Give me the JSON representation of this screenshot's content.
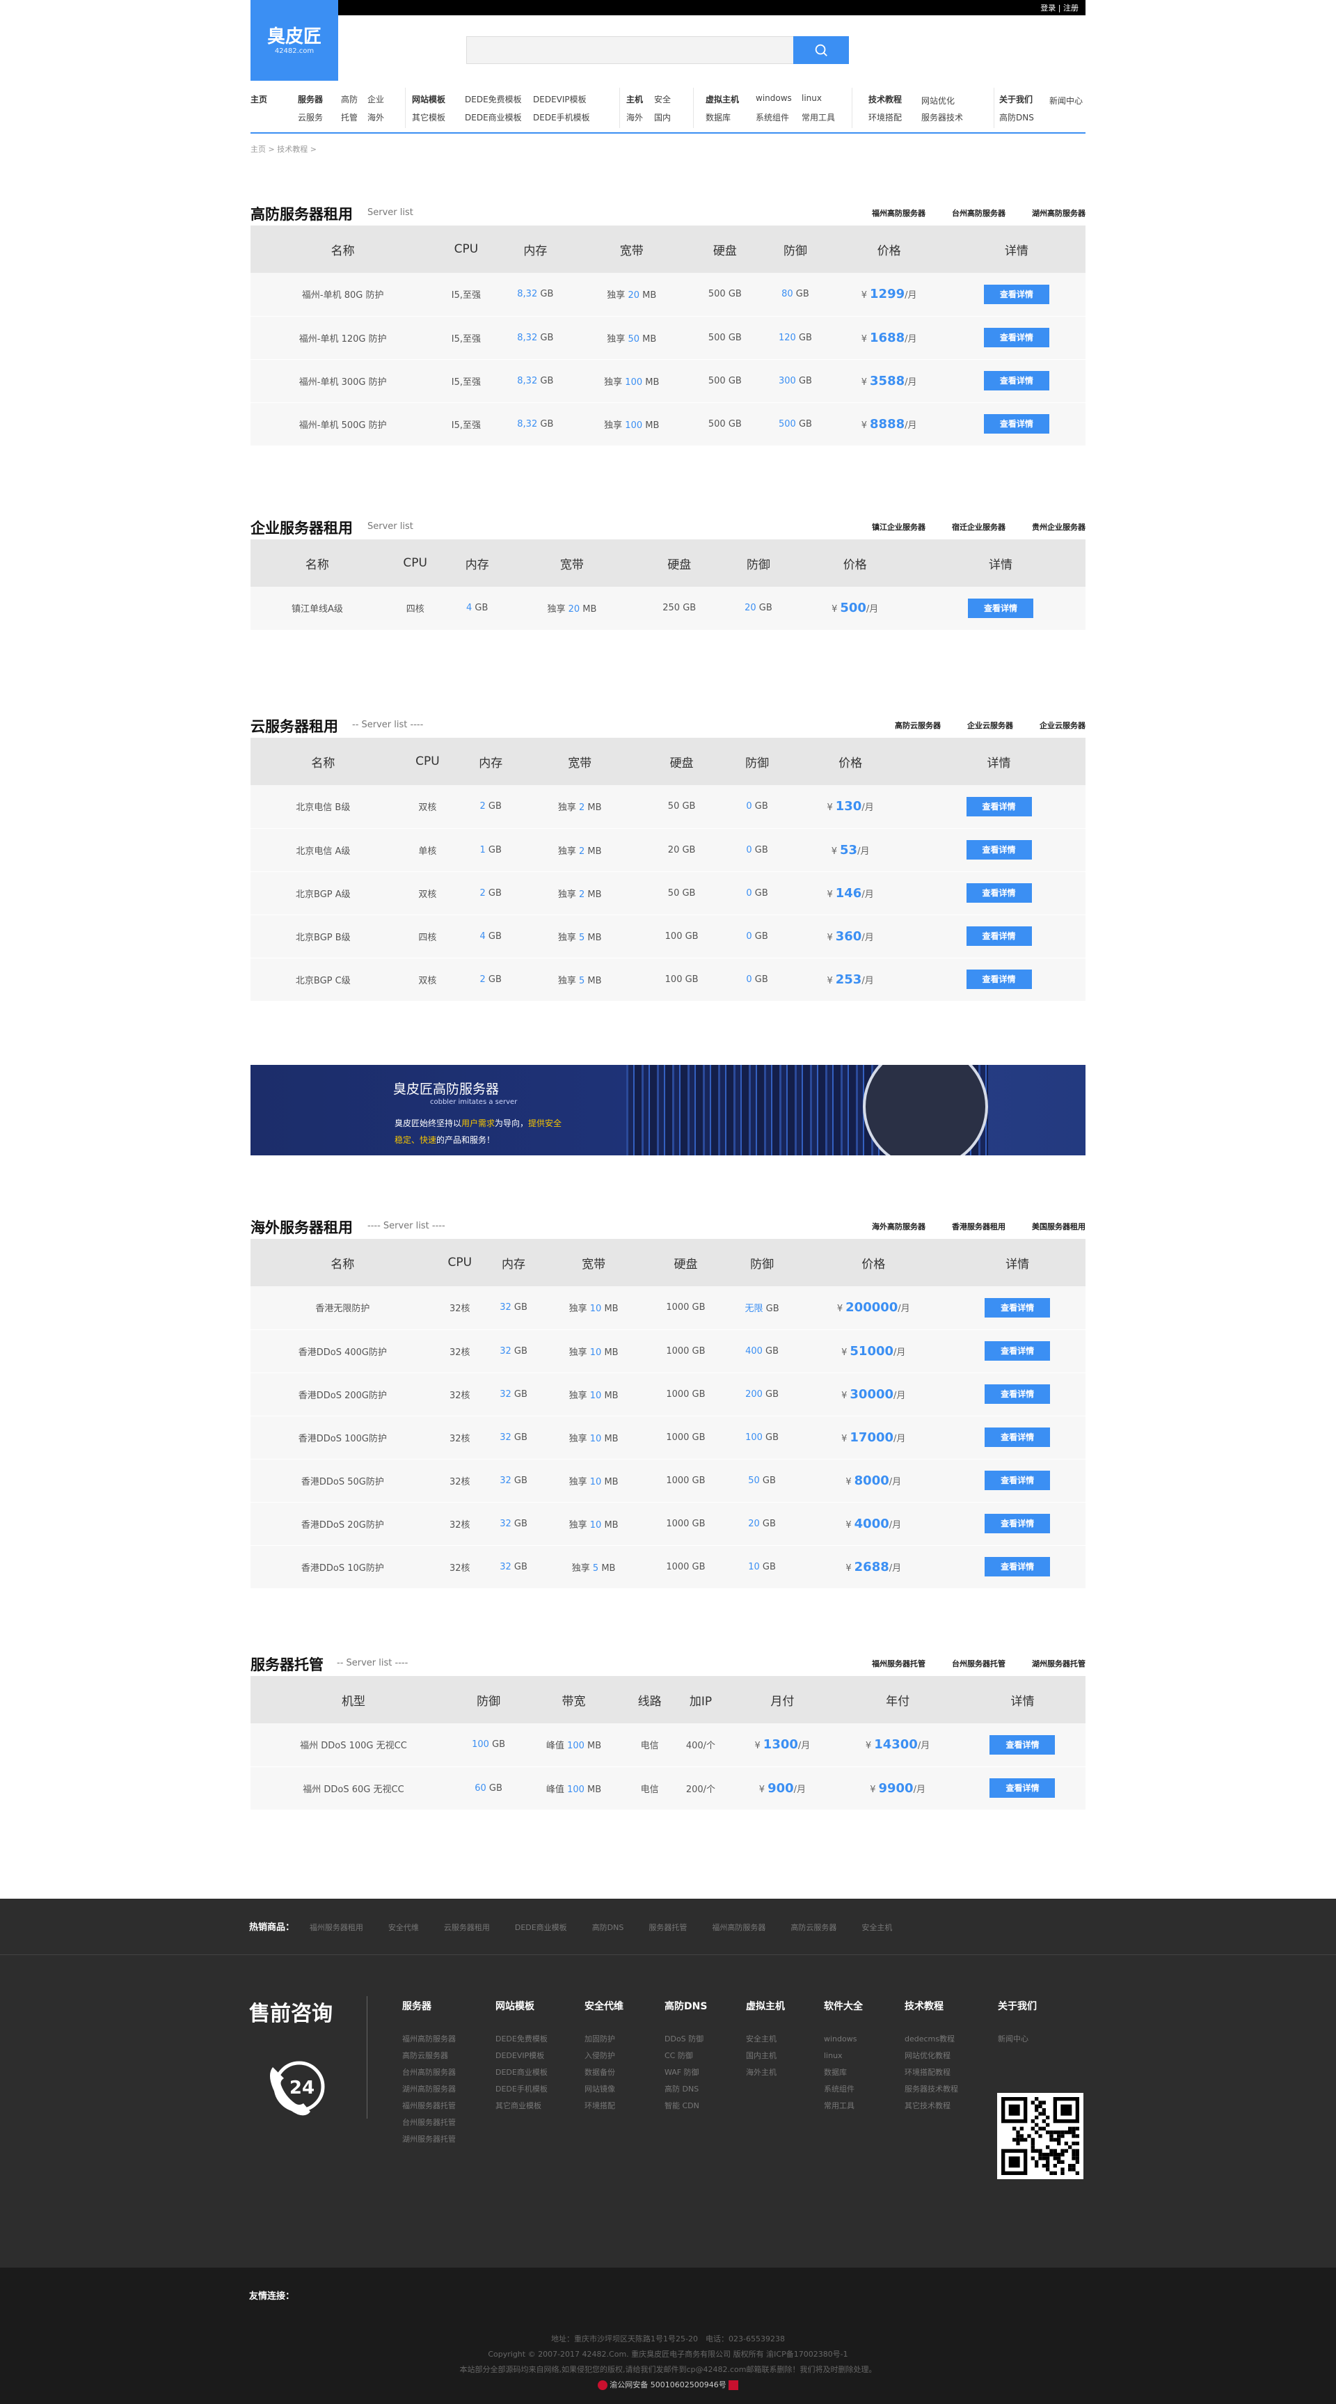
{
  "top_links": {
    "login": "登录",
    "sep": "|",
    "register": "注册"
  },
  "logo": {
    "mark": "臭皮匠",
    "sub": "42482.com"
  },
  "nav": [
    {
      "title": "主页",
      "items": []
    },
    {
      "title": "服务器",
      "items": [
        "高防",
        "企业",
        "云服务",
        "托管",
        "海外"
      ]
    },
    {
      "title": "网站模板",
      "items": [
        "DEDE免费模板",
        "DEDEVIP模板",
        "其它模板",
        "DEDE商业模板",
        "DEDE手机模板"
      ]
    },
    {
      "title": "主机",
      "items": [
        "安全",
        "海外",
        "国内"
      ]
    },
    {
      "title": "虚拟主机",
      "items": [
        "windows",
        "linux",
        "数据库",
        "系统组件",
        "常用工具"
      ]
    },
    {
      "title": "技术教程",
      "items": [
        "网站优化",
        "环境搭配",
        "服务器技术"
      ]
    },
    {
      "title": "关于我们",
      "items": [
        "新闻中心",
        "高防DNS"
      ]
    }
  ],
  "breadcrumb": "主页 >  技术教程 >",
  "sections": [
    {
      "title": "高防服务器租用",
      "sub": "Server list",
      "links": [
        "福州高防服务器",
        "台州高防服务器",
        "湖州高防服务器"
      ],
      "headers": [
        "名称",
        "CPU",
        "内存",
        "宽带",
        "硬盘",
        "防御",
        "价格",
        "详情"
      ],
      "rows": [
        [
          "福州-单机 80G 防护",
          "I5,至强",
          "8,32",
          "20",
          "500 GB",
          "80",
          "1299"
        ],
        [
          "福州-单机 120G 防护",
          "I5,至强",
          "8,32",
          "50",
          "500 GB",
          "120",
          "1688"
        ],
        [
          "福州-单机 300G 防护",
          "I5,至强",
          "8,32",
          "100",
          "500 GB",
          "300",
          "3588"
        ],
        [
          "福州-单机 500G 防护",
          "I5,至强",
          "8,32",
          "100",
          "500 GB",
          "500",
          "8888"
        ]
      ]
    },
    {
      "title": "企业服务器租用",
      "sub": "Server list",
      "links": [
        "镇江企业服务器",
        "宿迁企业服务器",
        "贵州企业服务器"
      ],
      "headers": [
        "名称",
        "CPU",
        "内存",
        "宽带",
        "硬盘",
        "防御",
        "价格",
        "详情"
      ],
      "rows": [
        [
          "镇江单线A级",
          "四核",
          "4",
          "20",
          "250 GB",
          "20",
          "500"
        ]
      ]
    },
    {
      "title": "云服务器租用",
      "sub": "-- Server list ----",
      "links": [
        "高防云服务器",
        "企业云服务器",
        "企业云服务器"
      ],
      "headers": [
        "名称",
        "CPU",
        "内存",
        "宽带",
        "硬盘",
        "防御",
        "价格",
        "详情"
      ],
      "rows": [
        [
          "北京电信 B级",
          "双核",
          "2",
          "2",
          "50 GB",
          "0",
          "130"
        ],
        [
          "北京电信 A级",
          "单核",
          "1",
          "2",
          "20 GB",
          "0",
          "53"
        ],
        [
          "北京BGP A级",
          "双核",
          "2",
          "2",
          "50 GB",
          "0",
          "146"
        ],
        [
          "北京BGP B级",
          "四核",
          "4",
          "5",
          "100 GB",
          "0",
          "360"
        ],
        [
          "北京BGP C级",
          "双核",
          "2",
          "5",
          "100 GB",
          "0",
          "253"
        ]
      ]
    },
    {
      "title": "海外服务器租用",
      "sub": "---- Server list ----",
      "links": [
        "海外高防服务器",
        "香港服务器租用",
        "美国服务器租用"
      ],
      "headers": [
        "名称",
        "CPU",
        "内存",
        "宽带",
        "硬盘",
        "防御",
        "价格",
        "详情"
      ],
      "rows": [
        [
          "香港无限防护",
          "32核",
          "32",
          "10",
          "1000 GB",
          "无限",
          "200000"
        ],
        [
          "香港DDoS 400G防护",
          "32核",
          "32",
          "10",
          "1000 GB",
          "400",
          "51000"
        ],
        [
          "香港DDoS 200G防护",
          "32核",
          "32",
          "10",
          "1000 GB",
          "200",
          "30000"
        ],
        [
          "香港DDoS 100G防护",
          "32核",
          "32",
          "10",
          "1000 GB",
          "100",
          "17000"
        ],
        [
          "香港DDoS 50G防护",
          "32核",
          "32",
          "10",
          "1000 GB",
          "50",
          "8000"
        ],
        [
          "香港DDoS 20G防护",
          "32核",
          "32",
          "10",
          "1000 GB",
          "20",
          "4000"
        ],
        [
          "香港DDoS 10G防护",
          "32核",
          "32",
          "5",
          "1000 GB",
          "10",
          "2688"
        ]
      ]
    }
  ],
  "hosting": {
    "title": "服务器托管",
    "sub": "-- Server list ----",
    "links": [
      "福州服务器托管",
      "台州服务器托管",
      "湖州服务器托管"
    ],
    "headers": [
      "机型",
      "防御",
      "带宽",
      "线路",
      "加IP",
      "月付",
      "年付",
      "详情"
    ],
    "rows": [
      [
        "福州 DDoS 100G 无视CC",
        "100",
        "100",
        "电信",
        "400/个",
        "1300",
        "14300"
      ],
      [
        "福州 DDoS 60G 无视CC",
        "60",
        "100",
        "电信",
        "200/个",
        "900",
        "9900"
      ]
    ]
  },
  "labels": {
    "gb": " GB",
    "mb": " MB",
    "share": "独享 ",
    "peak": "峰值 ",
    "yen": "¥",
    "per_month": "/月",
    "per_year": "/月",
    "detail": "查看详情"
  },
  "banner": {
    "title": "臭皮匠高防服务器",
    "sub": "cobbler imitates a server",
    "line1a": "臭皮匠始终坚持以",
    "line1b": "用户需求",
    "line1c": "为导向，",
    "line1d": "提供安全",
    "line2a": "稳定、快速",
    "line2b": "的产品和服务！"
  },
  "footer": {
    "hot_label": "热销商品：",
    "hot_items": [
      "福州服务器租用",
      "安全代维",
      "云服务器租用",
      "DEDE商业模板",
      "高防DNS",
      "服务器托管",
      "福州高防服务器",
      "高防云服务器",
      "安全主机"
    ],
    "consult": "售前咨询",
    "phone_badge": "24",
    "cols": [
      {
        "title": "服务器",
        "links": [
          "福州高防服务器",
          "高防云服务器",
          "台州高防服务器",
          "湖州高防服务器",
          "福州服务器托管",
          "台州服务器托管",
          "湖州服务器托管"
        ]
      },
      {
        "title": "网站模板",
        "links": [
          "DEDE免费模板",
          "DEDEVIP模板",
          "DEDE商业模板",
          "DEDE手机模板",
          "其它商业模板"
        ]
      },
      {
        "title": "安全代维",
        "links": [
          "加固防护",
          "入侵防护",
          "数据备份",
          "网站镜像",
          "环境搭配"
        ]
      },
      {
        "title": "高防DNS",
        "links": [
          "DDoS 防御",
          "CC 防御",
          "WAF 防御",
          "高防 DNS",
          "智能 CDN"
        ]
      },
      {
        "title": "虚拟主机",
        "links": [
          "安全主机",
          "国内主机",
          "海外主机"
        ]
      },
      {
        "title": "软件大全",
        "links": [
          "windows",
          "linux",
          "数据库",
          "系统组件",
          "常用工具"
        ]
      },
      {
        "title": "技术教程",
        "links": [
          "dedecms教程",
          "网站优化教程",
          "环境搭配教程",
          "服务器技术教程",
          "其它技术教程"
        ]
      },
      {
        "title": "关于我们",
        "links": [
          "新闻中心"
        ]
      }
    ],
    "friend": "友情连接：",
    "addr": "地址：重庆市沙坪坝区天陈路1号1号25-20　电话：023-65539238",
    "copyright": "Copyright © 2007-2017 42482.Com. 重庆臭皮匠电子商务有限公司 版权所有  渝ICP备17002380号-1",
    "notice": "本站部分全部源码均来自网络,如果侵犯您的版权,请给我们发邮件到cp@42482.com邮箱联系删除！我们将及时删除处理。",
    "police": "渝公网安备 50010602500946号"
  }
}
